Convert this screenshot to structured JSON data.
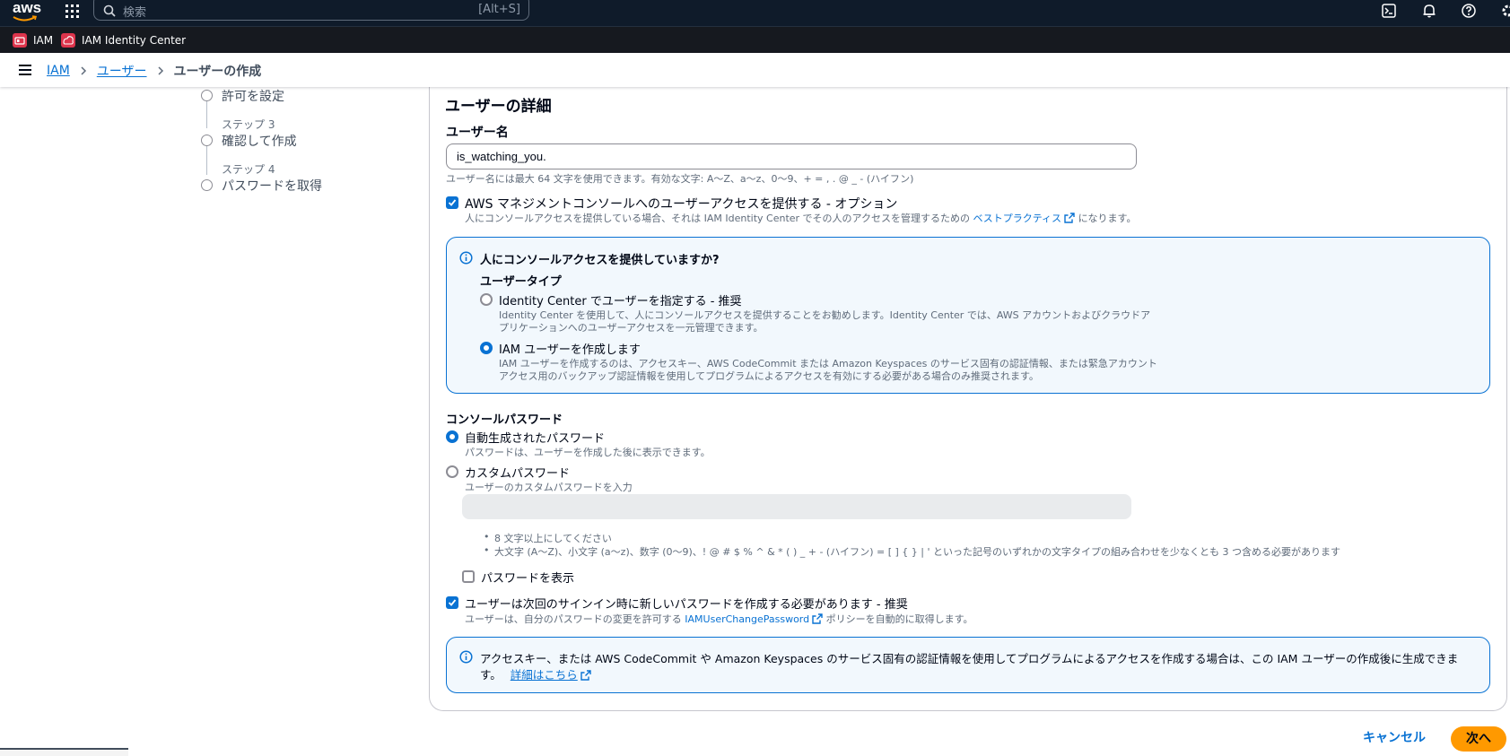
{
  "topnav": {
    "logo_text": "aws",
    "search_placeholder": "検索",
    "search_shortcut": "[Alt+S]",
    "icons": [
      "grid-icon",
      "cloudshell-icon",
      "bell-icon",
      "help-icon",
      "gear-icon"
    ]
  },
  "servicebar": {
    "items": [
      {
        "label": "IAM",
        "icon": "iam-icon"
      },
      {
        "label": "IAM Identity Center",
        "icon": "identity-center-icon"
      }
    ]
  },
  "breadcrumb": {
    "items": [
      "IAM",
      "ユーザー"
    ],
    "current": "ユーザーの作成"
  },
  "steps": [
    {
      "name": "許可を設定"
    },
    {
      "label": "ステップ 3",
      "name": "確認して作成"
    },
    {
      "label": "ステップ 4",
      "name": "パスワードを取得"
    }
  ],
  "details": {
    "title": "ユーザーの詳細",
    "username_label": "ユーザー名",
    "username_value": "is_watching_you.",
    "username_hint": "ユーザー名には最大 64 文字を使用できます。有効な文字: A〜Z、a〜z、0〜9、+ = , . @ _ - (ハイフン)",
    "console_access_label": "AWS マネジメントコンソールへのユーザーアクセスを提供する - オプション",
    "console_access_desc_pre": "人にコンソールアクセスを提供している場合、それは IAM Identity Center でその人のアクセスを管理するための",
    "console_access_link": "ベストプラクティス",
    "console_access_desc_post": "になります。"
  },
  "usertype_alert": {
    "title": "人にコンソールアクセスを提供していますか?",
    "group_label": "ユーザータイプ",
    "option1_label": "Identity Center でユーザーを指定する - 推奨",
    "option1_desc1": "Identity Center を使用して、人にコンソールアクセスを提供することをお勧めします。Identity Center では、AWS アカウントおよびクラウドア",
    "option1_desc2": "プリケーションへのユーザーアクセスを一元管理できます。",
    "option2_label": "IAM ユーザーを作成します",
    "option2_desc1": "IAM ユーザーを作成するのは、アクセスキー、AWS CodeCommit または Amazon Keyspaces のサービス固有の認証情報、または緊急アカウント",
    "option2_desc2": "アクセス用のバックアップ認証情報を使用してプログラムによるアクセスを有効にする必要がある場合のみ推奨されます。",
    "selected": "option2"
  },
  "password": {
    "label": "コンソールパスワード",
    "auto_label": "自動生成されたパスワード",
    "auto_desc": "パスワードは、ユーザーを作成した後に表示できます。",
    "custom_label": "カスタムパスワード",
    "custom_desc": "ユーザーのカスタムパスワードを入力",
    "custom_value": "",
    "rule1": "8 文字以上にしてください",
    "rule2": "大文字 (A〜Z)、小文字 (a〜z)、数字 (0〜9)、! @ # $ % ^ & * ( ) _ + - (ハイフン) = [ ] { } | ' といった記号のいずれかの文字タイプの組み合わせを少なくとも 3 つ含める必要があります",
    "show_label": "パスワードを表示",
    "reset_label": "ユーザーは次回のサインイン時に新しいパスワードを作成する必要があります - 推奨",
    "reset_desc_pre": "ユーザーは、自分のパスワードの変更を許可する",
    "reset_link": "IAMUserChangePassword",
    "reset_desc_post": "ポリシーを自動的に取得します。",
    "selected": "auto"
  },
  "accesskey_alert": {
    "text1": "アクセスキー、または AWS CodeCommit や Amazon Keyspaces のサービス固有の認証情報を使用してプログラムによるアクセスを作成する場合は、この IAM ユーザーの作成後に生成できま",
    "text2": "す。",
    "link": "詳細はこちら"
  },
  "footer": {
    "cancel": "キャンセル",
    "next": "次へ"
  },
  "colors": {
    "primary": "#0972d3",
    "nav_bg": "#0f1b2a",
    "next_button": "#ff9900",
    "alert_bg": "#f2f8fd"
  }
}
